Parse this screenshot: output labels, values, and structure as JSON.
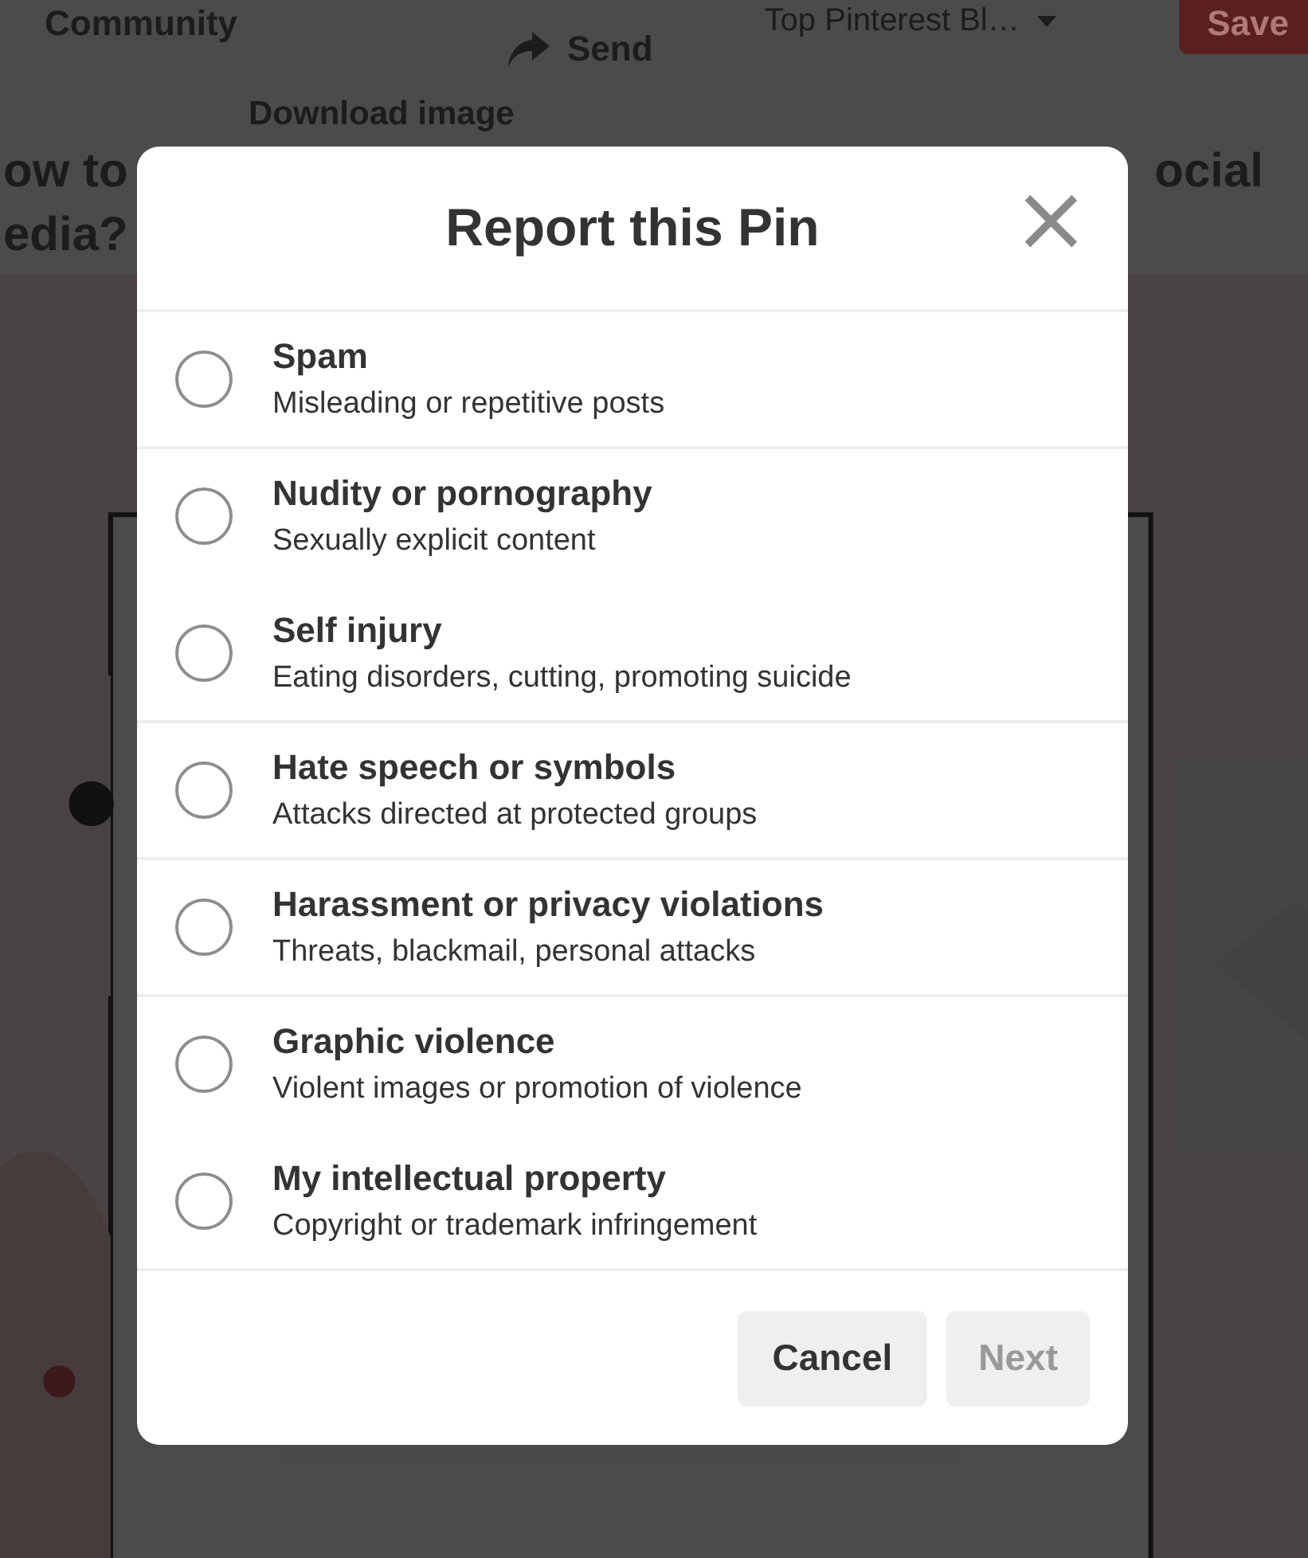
{
  "page": {
    "community": "Community",
    "send": "Send",
    "board": "Top Pinterest Bl…",
    "save": "Save",
    "download": "Download image",
    "title_left_1": "ow to",
    "title_left_2": "edia?",
    "title_right": "ocial"
  },
  "dialog": {
    "title": "Report this Pin",
    "close": "×",
    "options": [
      {
        "title": "Spam",
        "description": "Misleading or repetitive posts",
        "selected": false,
        "divider_below": true
      },
      {
        "title": "Nudity or pornography",
        "description": "Sexually explicit content",
        "selected": false,
        "divider_below": false
      },
      {
        "title": "Self injury",
        "description": "Eating disorders, cutting, promoting suicide",
        "selected": false,
        "divider_below": true
      },
      {
        "title": "Hate speech or symbols",
        "description": "Attacks directed at protected groups",
        "selected": false,
        "divider_below": true
      },
      {
        "title": "Harassment or privacy violations",
        "description": "Threats, blackmail, personal attacks",
        "selected": false,
        "divider_below": true
      },
      {
        "title": "Graphic violence",
        "description": "Violent images or promotion of violence",
        "selected": false,
        "divider_below": false
      },
      {
        "title": "My intellectual property",
        "description": "Copyright or trademark infringement",
        "selected": false,
        "divider_below": true
      }
    ],
    "buttons": [
      {
        "label": "Cancel",
        "disabled": false
      },
      {
        "label": "Next",
        "disabled": true
      }
    ]
  }
}
